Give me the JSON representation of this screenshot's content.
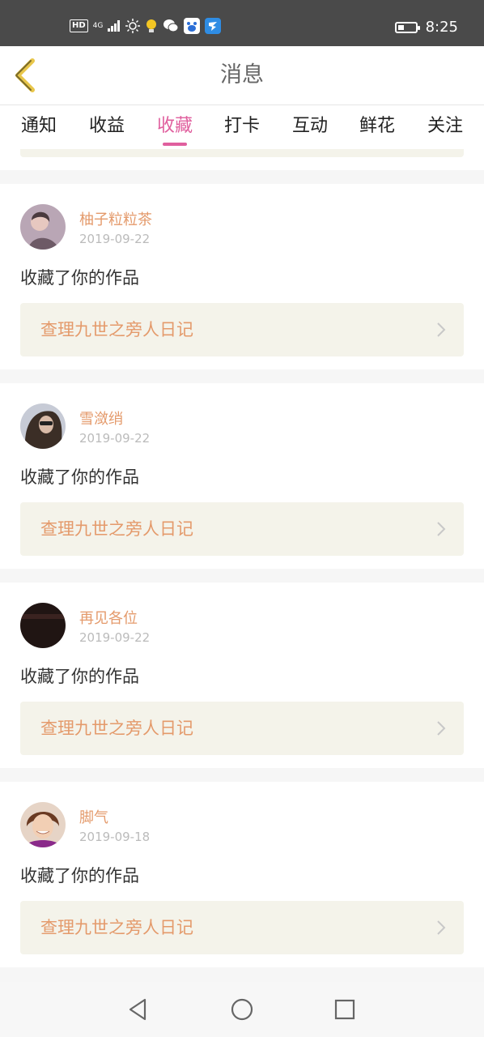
{
  "status_bar": {
    "hd": "HD",
    "network": "4G",
    "time": "8:25",
    "battery_level": 0.35
  },
  "header": {
    "title": "消息"
  },
  "tabs": [
    {
      "label": "通知"
    },
    {
      "label": "收益"
    },
    {
      "label": "收藏",
      "active": true
    },
    {
      "label": "打卡"
    },
    {
      "label": "互动"
    },
    {
      "label": "鲜花"
    },
    {
      "label": "关注"
    }
  ],
  "notifications": [
    {
      "username": "柚子粒粒茶",
      "date": "2019-09-22",
      "action": "收藏了你的作品",
      "work_title": "查理九世之旁人日记"
    },
    {
      "username": "雪潋绡",
      "date": "2019-09-22",
      "action": "收藏了你的作品",
      "work_title": "查理九世之旁人日记"
    },
    {
      "username": "再见各位",
      "date": "2019-09-22",
      "action": "收藏了你的作品",
      "work_title": "查理九世之旁人日记"
    },
    {
      "username": "脚气",
      "date": "2019-09-18",
      "action": "收藏了你的作品",
      "work_title": "查理九世之旁人日记"
    }
  ],
  "colors": {
    "accent_pink": "#e05f9e",
    "username_orange": "#e49a6b",
    "back_arrow_yellow": "#e8c64a",
    "link_background": "#f4f3ea"
  }
}
